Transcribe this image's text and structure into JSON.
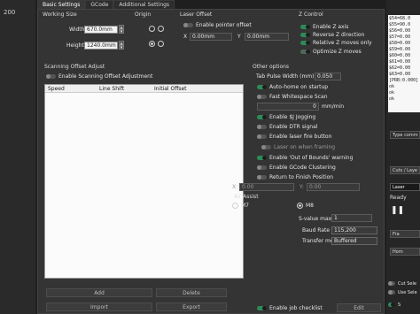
{
  "left_strip": {
    "ruler_value": "200"
  },
  "tabs": [
    "Basic Settings",
    "GCode",
    "Additional Settings"
  ],
  "working_size": {
    "title": "Working Size",
    "width_label": "Width",
    "width_value": "670.0mm",
    "height_label": "Height",
    "height_value": "1240.0mm"
  },
  "origin": {
    "title": "Origin"
  },
  "laser_offset": {
    "title": "Laser Offset",
    "enable_label": "Enable pointer offset",
    "x_label": "X",
    "x_value": "0.00mm",
    "y_label": "Y",
    "y_value": "0.00mm"
  },
  "z_control": {
    "title": "Z Control",
    "items": [
      "Enable Z axis",
      "Reverse Z direction",
      "Relative Z moves only",
      "Optimize Z moves"
    ]
  },
  "scanning": {
    "title": "Scanning Offset Adjust",
    "enable_label": "Enable Scanning Offset Adjustment",
    "columns": [
      "Speed",
      "Line Shift",
      "Initial Offset"
    ],
    "add_label": "Add",
    "delete_label": "Delete",
    "import_label": "Import",
    "export_label": "Export"
  },
  "other": {
    "title": "Other options",
    "tab_pulse_label": "Tab Pulse Width (mm)",
    "tab_pulse_value": "0.050",
    "auto_home": "Auto-home on startup",
    "fast_whitespace": "Fast Whitespace Scan",
    "whitespace_value": "0",
    "whitespace_unit": "mm/min",
    "toggles": [
      "Enable $J Jogging",
      "Enable DTR signal",
      "Enable laser fire button",
      "Laser on when framing",
      "Enable 'Out of Bounds' warning",
      "Enable GCode Clustering",
      "Return to Finish Position"
    ],
    "finish_x_label": "X:",
    "finish_x_value": "0.00",
    "finish_y_label": "Y:",
    "finish_y_value": "0.00",
    "air_assist_label": "Air Assist",
    "m7_label": "M7",
    "m8_label": "M8",
    "svalue_label": "S-value max",
    "svalue_value": "1",
    "baud_label": "Baud Rate",
    "baud_value": "115,200",
    "transfer_label": "Transfer mode",
    "transfer_value": "Buffered",
    "job_checklist": "Enable job checklist",
    "edit_label": "Edit"
  },
  "right_panel": {
    "console_lines": [
      "$54=68.0",
      "$55=90.0",
      "$56=0.00",
      "$57=0.00",
      "$58=0.00",
      "$59=0.00",
      "$60=0.00",
      "$61=0.00",
      "$62=0.00",
      "$63=0.00",
      "[PRB:0.000]",
      "ok",
      "ok",
      "ok"
    ],
    "command_placeholder": "Type comm",
    "cuts_label": "Cuts / Laye",
    "laser_label": "Laser",
    "ready_label": "Ready",
    "fra_label": "Fra",
    "hom_label": "Hom",
    "cut_sel_label": "Cut Sele",
    "use_sel_label": "Use Sele",
    "s_label": "S"
  }
}
